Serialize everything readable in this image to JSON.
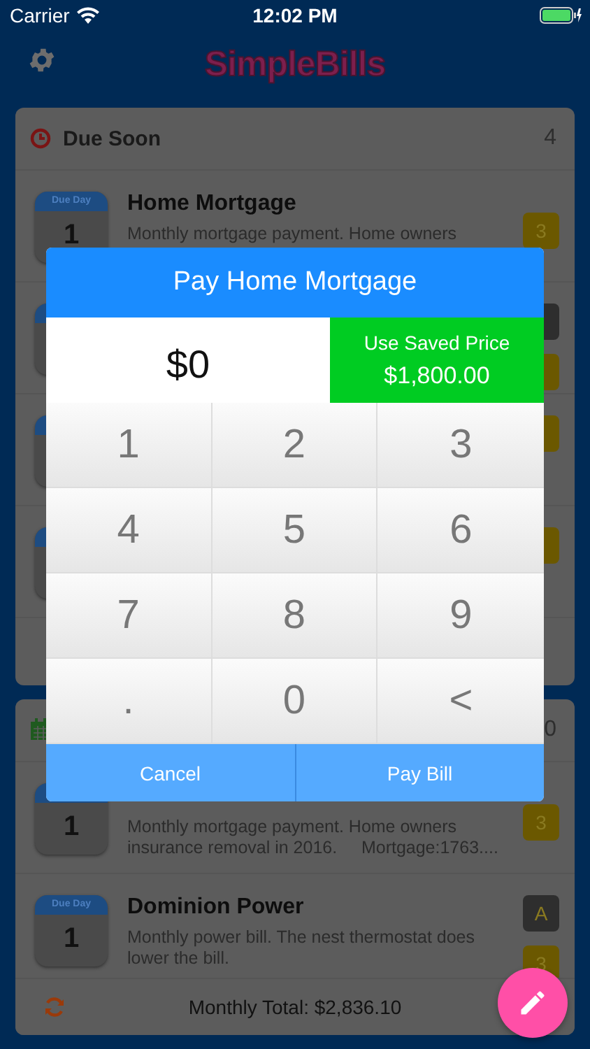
{
  "status_bar": {
    "carrier": "Carrier",
    "time": "12:02 PM"
  },
  "header": {
    "logo": "SimpleBills"
  },
  "due_soon": {
    "title": "Due Soon",
    "count": "4",
    "bills": [
      {
        "kind": "full",
        "due_label": "Due Day",
        "day": "1",
        "name": "Home Mortgage",
        "description": "Monthly mortgage payment. Home owners",
        "badges": [
          {
            "label": "3",
            "color": "#6b5800"
          }
        ]
      },
      {
        "kind": "covered",
        "badges": [
          {
            "color": "#2e2e2e"
          },
          {
            "color": "#6b5800"
          }
        ]
      },
      {
        "kind": "covered",
        "badges": [
          {
            "color": "#6b5800"
          }
        ]
      },
      {
        "kind": "covered",
        "badges": [
          {
            "color": "#6b5800"
          }
        ]
      }
    ]
  },
  "upcoming": {
    "count": "0",
    "bills": [
      {
        "day": "1",
        "description": "Monthly mortgage payment. Home owners insurance removal in 2016.     Mortgage:1763....",
        "badges": [
          {
            "label": "3",
            "color": "#6b5800"
          }
        ]
      },
      {
        "due_label": "Due Day",
        "day": "1",
        "name": "Dominion Power",
        "description": "Monthly power bill. The nest thermostat does lower the bill.",
        "badges": [
          {
            "label": "A",
            "color": "#2e2e2e"
          },
          {
            "label": "3",
            "color": "#6b5800"
          }
        ]
      }
    ]
  },
  "footer": {
    "total": "Monthly Total: $2,836.10"
  },
  "dialog": {
    "title": "Pay Home Mortgage",
    "amount": "$0",
    "saved_label": "Use Saved Price",
    "saved_price": "$1,800.00",
    "keys": [
      "1",
      "2",
      "3",
      "4",
      "5",
      "6",
      "7",
      "8",
      "9",
      ".",
      "0",
      "<"
    ],
    "buttons": [
      "Cancel",
      "Pay Bill"
    ]
  }
}
